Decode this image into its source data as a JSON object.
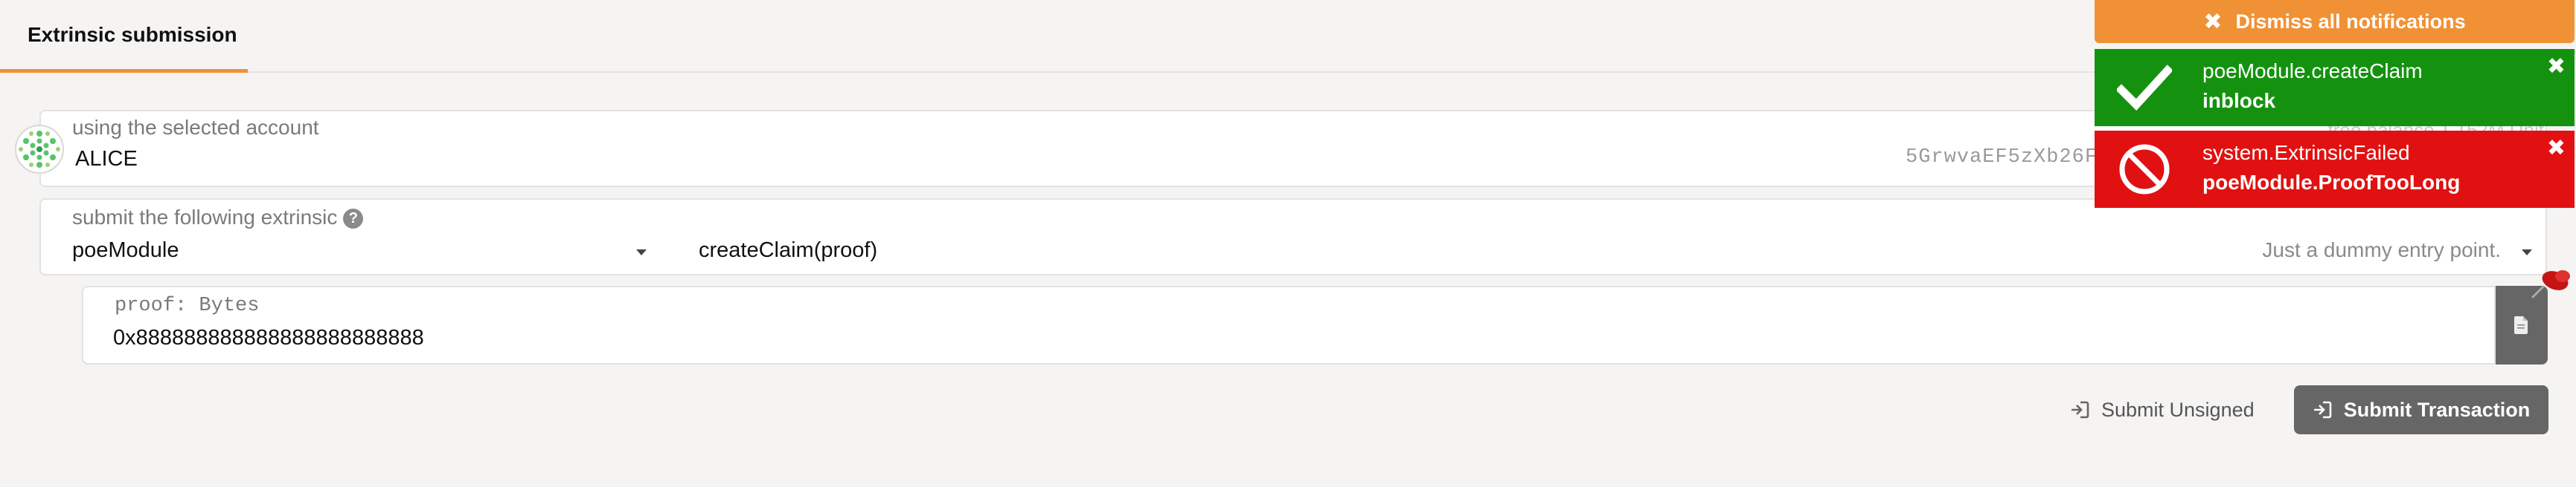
{
  "tabs": [
    {
      "label": "Extrinsic submission"
    }
  ],
  "account": {
    "label": "using the selected account",
    "name": "ALICE",
    "address": "5GrwvaEF5zXb26Fz",
    "free_balance": "free balance 1.152M Unit"
  },
  "extrinsic": {
    "label": "submit the following extrinsic",
    "module": "poeModule",
    "method": "createClaim(proof)",
    "method_desc": "Just a dummy entry point."
  },
  "param": {
    "label": "proof: Bytes",
    "value": "0x888888888888888888888888"
  },
  "buttons": {
    "submit_unsigned": "Submit Unsigned",
    "submit_transaction": "Submit Transaction"
  },
  "notifications": {
    "dismiss_all": "Dismiss all notifications",
    "items": [
      {
        "title": "poeModule.createClaim",
        "status": "inblock",
        "color": "#14920f"
      },
      {
        "title": "system.ExtrinsicFailed",
        "status": "poeModule.ProofTooLong",
        "color": "#e11111"
      }
    ]
  },
  "colors": {
    "accent": "#f19135",
    "success": "#14920f",
    "error": "#e11111",
    "button": "#666666"
  }
}
